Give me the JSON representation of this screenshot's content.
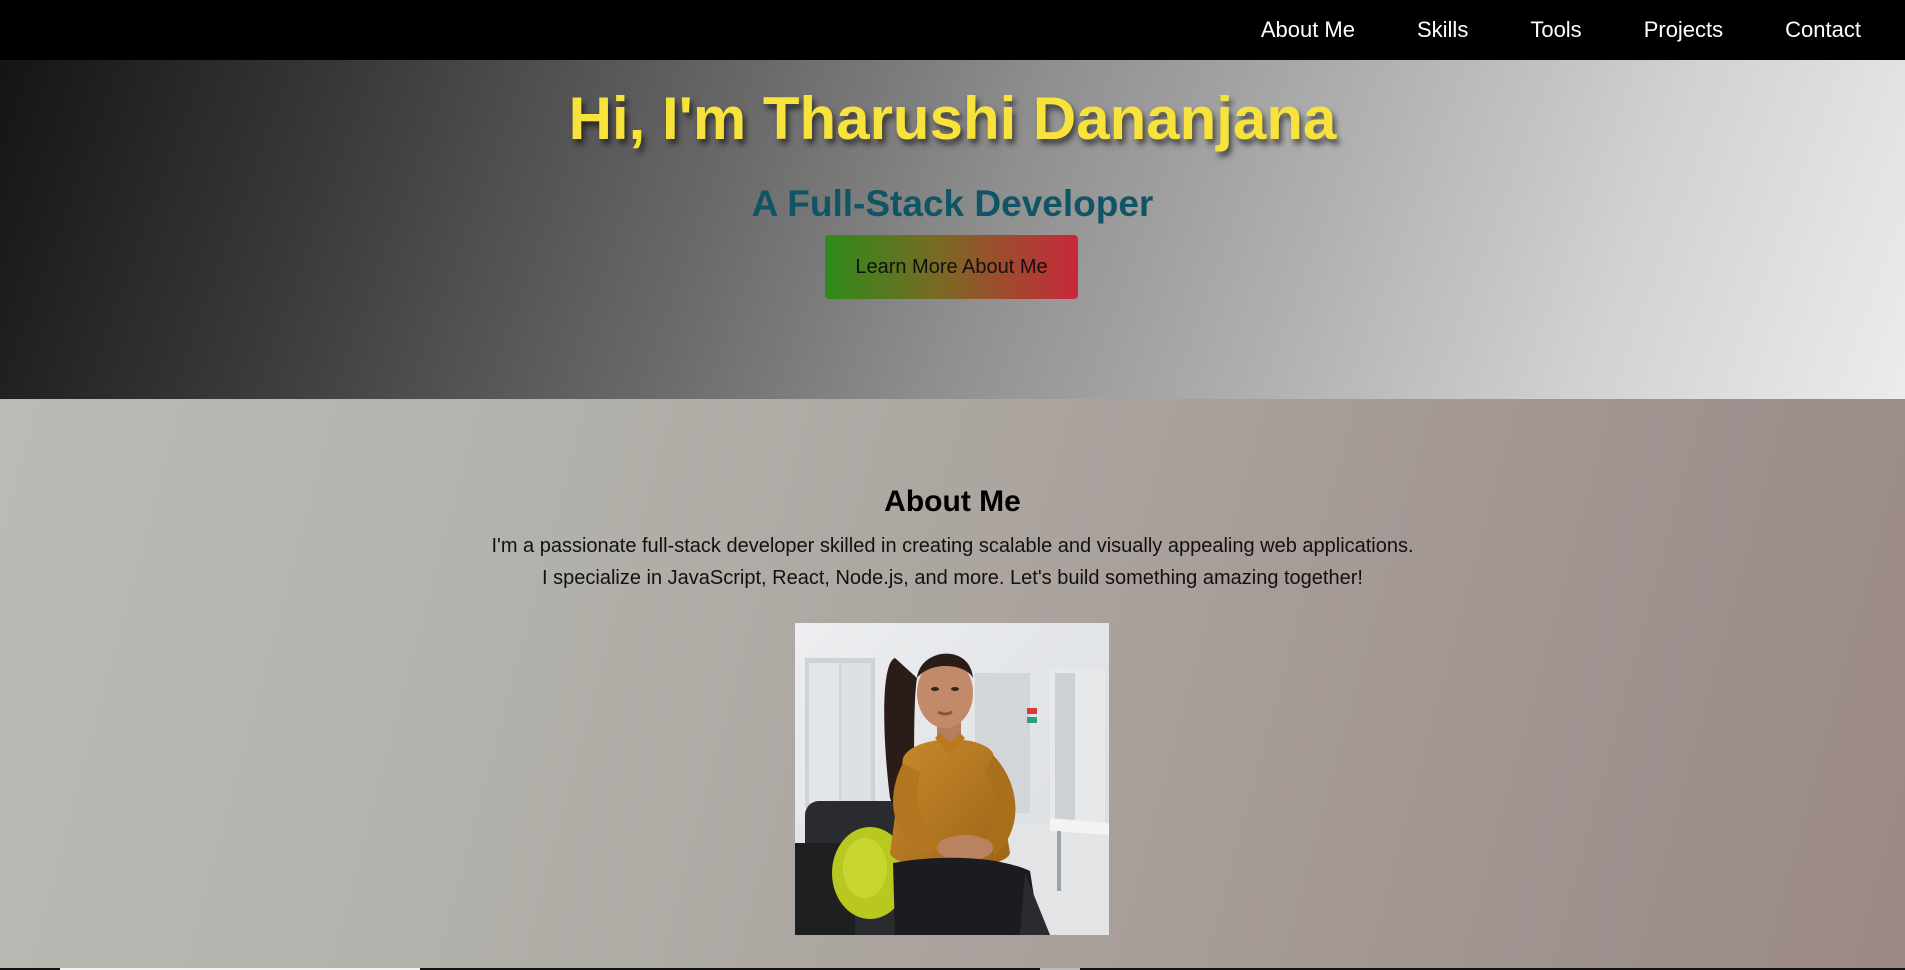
{
  "nav": {
    "items": [
      {
        "label": "About Me"
      },
      {
        "label": "Skills"
      },
      {
        "label": "Tools"
      },
      {
        "label": "Projects"
      },
      {
        "label": "Contact"
      }
    ]
  },
  "hero": {
    "title": "Hi, I'm Tharushi Dananjana",
    "subtitle": "A Full-Stack Developer",
    "button_label": "Learn More About Me",
    "colors": {
      "title": "#f7e33c",
      "subtitle": "#0f5566",
      "button_start": "#2e8a1a",
      "button_end": "#c8283a"
    }
  },
  "about": {
    "heading": "About Me",
    "line1": "I'm a passionate full-stack developer skilled in creating scalable and visually appealing web applications.",
    "line2": "I specialize in JavaScript, React, Node.js, and more. Let's build something amazing together!"
  }
}
